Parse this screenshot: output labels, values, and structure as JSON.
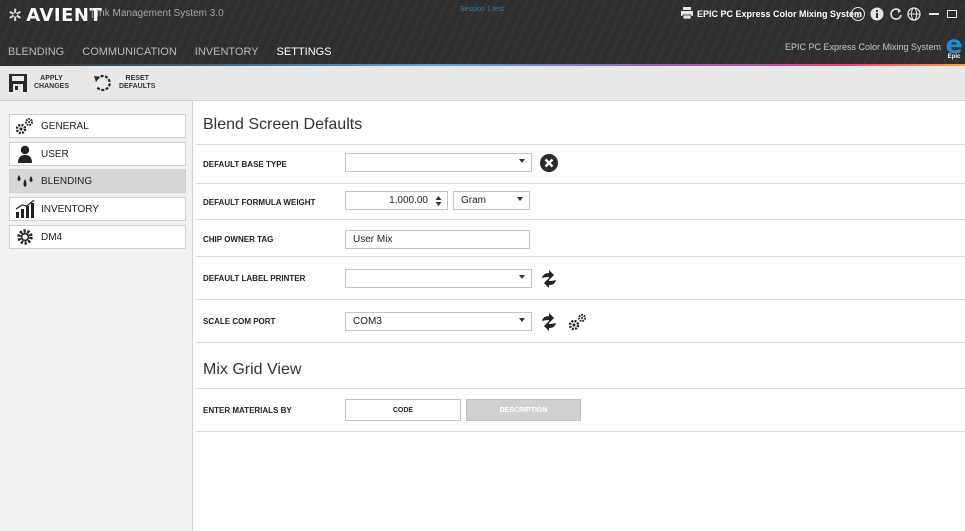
{
  "app": {
    "brand": "AVIENT",
    "title": "| Ink Management System 3.0",
    "session_badge": "Session 1 test",
    "system_title": "EPIC PC Express Color Mixing System",
    "system_subtitle": "EPIC PC Express Color Mixing System",
    "epic_logo_word": "Epic"
  },
  "nav": {
    "tabs": [
      {
        "label": "BLENDING"
      },
      {
        "label": "COMMUNICATION"
      },
      {
        "label": "INVENTORY"
      },
      {
        "label": "SETTINGS"
      }
    ]
  },
  "toolbar": {
    "apply_line1": "APPLY",
    "apply_line2": "CHANGES",
    "reset_line1": "RESET",
    "reset_line2": "DEFAULTS"
  },
  "sidebar": {
    "items": [
      {
        "label": "GENERAL",
        "icon": "gears-icon"
      },
      {
        "label": "USER",
        "icon": "user-icon"
      },
      {
        "label": "BLENDING",
        "icon": "drops-icon"
      },
      {
        "label": "INVENTORY",
        "icon": "chart-icon"
      },
      {
        "label": "DM4",
        "icon": "gear-icon"
      }
    ],
    "active_index": 2
  },
  "blend_defaults": {
    "title": "Blend Screen Defaults",
    "base_type": {
      "label": "DEFAULT BASE TYPE",
      "value": ""
    },
    "formula_weight": {
      "label": "DEFAULT FORMULA WEIGHT",
      "value": "1,000.00",
      "unit": "Gram"
    },
    "chip_owner": {
      "label": "CHIP OWNER TAG",
      "value": "User Mix"
    },
    "label_printer": {
      "label": "DEFAULT LABEL PRINTER",
      "value": ""
    },
    "scale_port": {
      "label": "SCALE COM PORT",
      "value": "COM3"
    }
  },
  "mix_grid": {
    "title": "Mix Grid View",
    "enter_by": {
      "label": "ENTER MATERIALS BY",
      "options": [
        "CODE",
        "DESCRIPTION"
      ],
      "selected": "CODE"
    }
  },
  "colors": {
    "accent": "#1d8fd6",
    "titlebar": "#2f2f2f",
    "selected_side": "#d6d6d6",
    "disabled_btn": "#d0d0d0"
  }
}
